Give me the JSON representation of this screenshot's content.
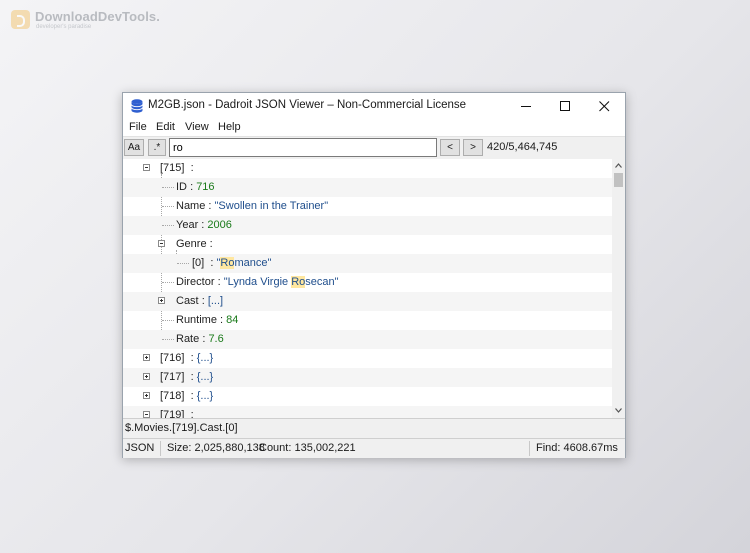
{
  "watermark": {
    "title": "DownloadDevTools.",
    "subtitle": "developer's paradise"
  },
  "window": {
    "title": "M2GB.json - Dadroit JSON Viewer – Non-Commercial License",
    "minimize_icon": "minimize-icon",
    "maximize_icon": "maximize-icon",
    "close_icon": "close-icon"
  },
  "menu": [
    "File",
    "Edit",
    "View",
    "Help"
  ],
  "search": {
    "case_button": "Aa",
    "regex_button": ".*",
    "query": "ro",
    "prev_button": "<",
    "next_button": ">",
    "match_count": "420/5,464,745"
  },
  "tree": {
    "node_715": {
      "key": "[715]",
      "sep": ":"
    },
    "id": {
      "key": "ID",
      "sep": ":",
      "value": "716"
    },
    "name": {
      "key": "Name",
      "sep": ":",
      "value": "\"Swollen in the Trainer\""
    },
    "year": {
      "key": "Year",
      "sep": ":",
      "value": "2006"
    },
    "genre": {
      "key": "Genre",
      "sep": ":"
    },
    "genre_0": {
      "key": "[0]",
      "sep": ":",
      "v_pre": "\"",
      "v_hl": "Ro",
      "v_post": "mance\""
    },
    "director": {
      "key": "Director",
      "sep": ":",
      "v_pre": "\"Lynda Virgie ",
      "v_hl": "Ro",
      "v_post": "secan\""
    },
    "cast": {
      "key": "Cast",
      "sep": ":",
      "value": "[...]"
    },
    "runtime": {
      "key": "Runtime",
      "sep": ":",
      "value": "84"
    },
    "rate": {
      "key": "Rate",
      "sep": ":",
      "value": "7.6"
    },
    "node_716": {
      "key": "[716]",
      "sep": ":",
      "value": "{...}"
    },
    "node_717": {
      "key": "[717]",
      "sep": ":",
      "value": "{...}"
    },
    "node_718": {
      "key": "[718]",
      "sep": ":",
      "value": "{...}"
    },
    "node_719": {
      "key": "[719]",
      "sep": ":"
    }
  },
  "path": "$.Movies.[719].Cast.[0]",
  "status": {
    "format": "JSON",
    "size": "Size: 2,025,880,138",
    "count": "Count: 135,002,221",
    "find": "Find: 4608.67ms"
  },
  "colors": {
    "number": "#1a7a1a",
    "string": "#1f4e8c",
    "highlight": "#ffe7a0"
  }
}
